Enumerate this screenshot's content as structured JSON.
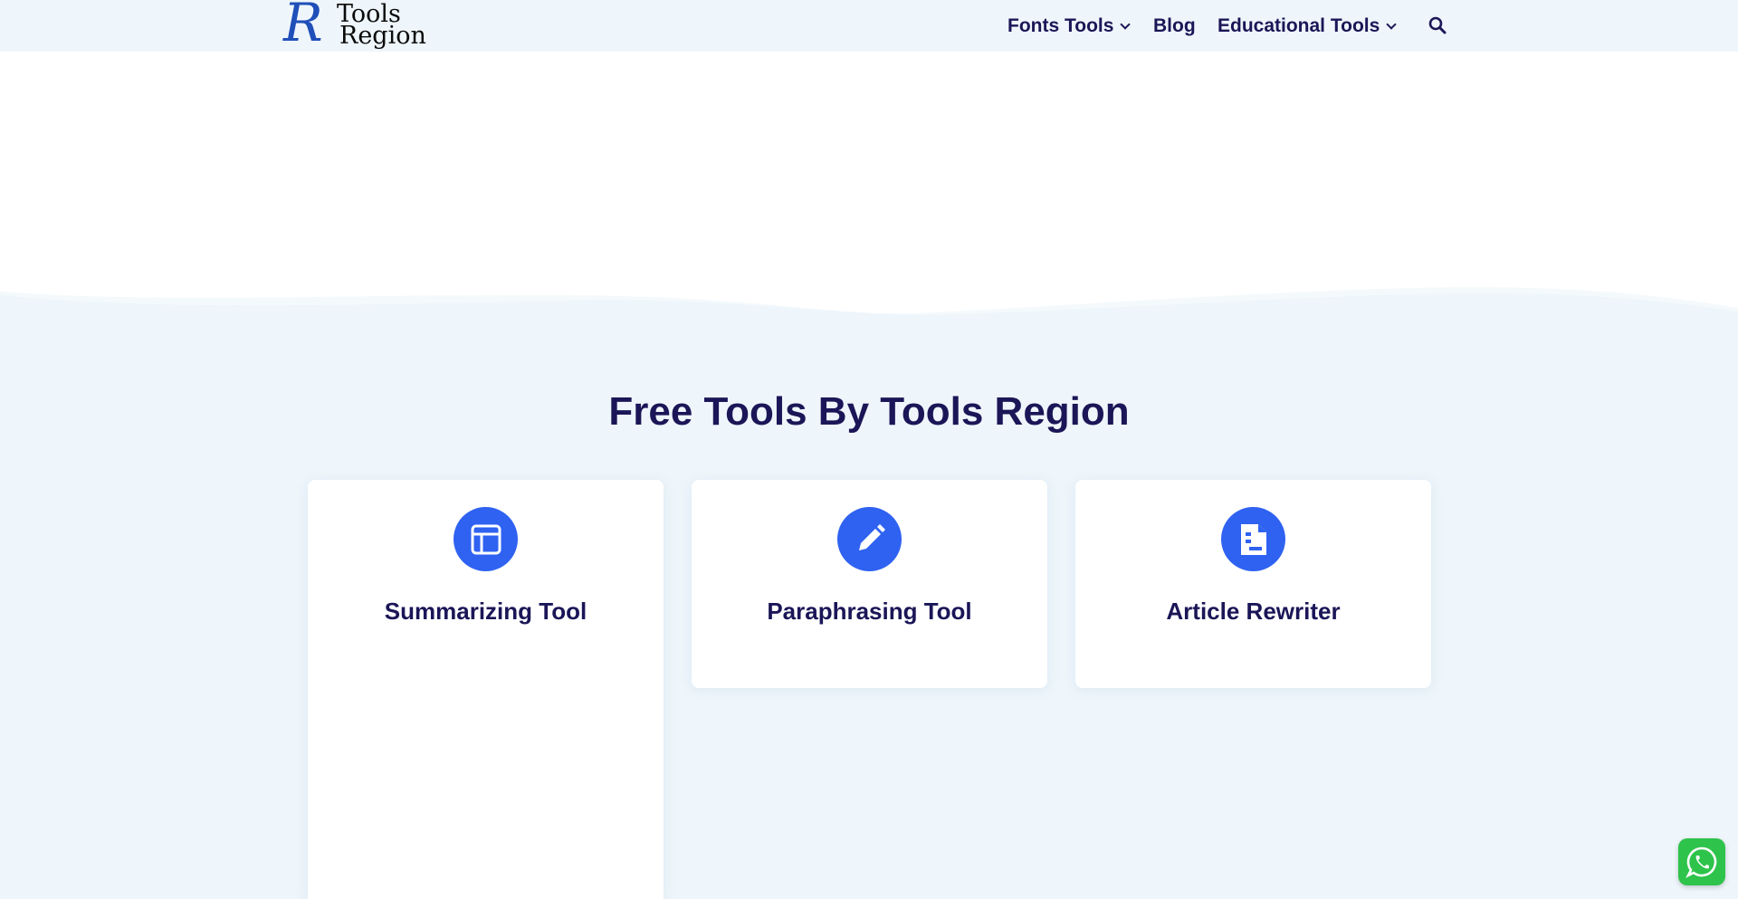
{
  "header": {
    "logo": {
      "letter": "R",
      "line1": "Tools",
      "line2": "Region",
      "alt_name": "tools-region-logo"
    },
    "nav": [
      {
        "label": "Fonts Tools",
        "has_dropdown": true
      },
      {
        "label": "Blog",
        "has_dropdown": false
      },
      {
        "label": "Educational Tools",
        "has_dropdown": true
      }
    ],
    "search_icon": "search-icon"
  },
  "section": {
    "title": "Free Tools By Tools Region"
  },
  "cards": [
    {
      "title": "Summarizing Tool",
      "icon": "layout-icon"
    },
    {
      "title": "Paraphrasing Tool",
      "icon": "pencil-icon"
    },
    {
      "title": "Article Rewriter",
      "icon": "document-icon"
    }
  ],
  "floating": {
    "icon": "whatsapp-icon"
  },
  "colors": {
    "accent": "#2f62f1",
    "heading": "#1b1657",
    "background": "#eef6fb",
    "whatsapp": "#2ec34a"
  }
}
